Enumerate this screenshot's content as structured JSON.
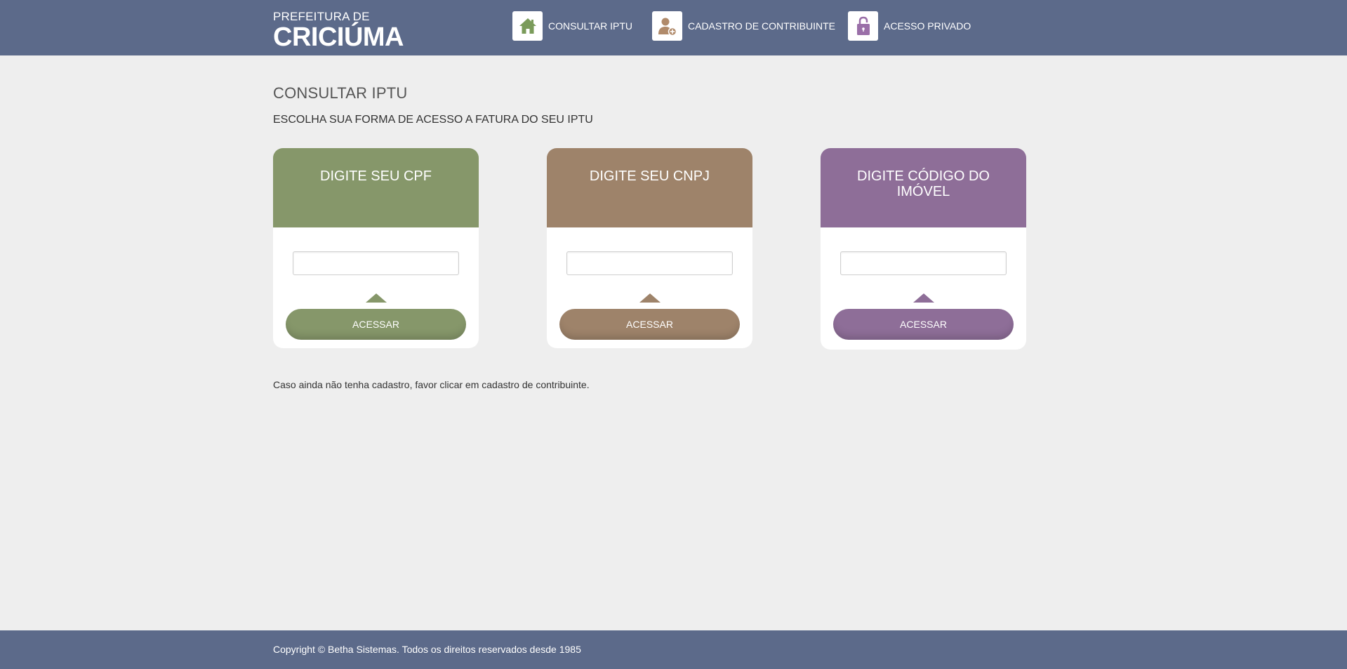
{
  "brand": {
    "top": "PREFEITURA DE",
    "main": "CRICIÚMA"
  },
  "nav": {
    "items": [
      {
        "label": "CONSULTAR IPTU",
        "icon": "house-icon"
      },
      {
        "label": "CADASTRO DE CONTRIBUINTE",
        "icon": "user-add-icon"
      },
      {
        "label": "ACESSO PRIVADO",
        "icon": "lock-icon"
      }
    ]
  },
  "main": {
    "title": "CONSULTAR IPTU",
    "subtitle": "ESCOLHA SUA FORMA DE ACESSO A FATURA DO SEU IPTU",
    "note": "Caso ainda não tenha cadastro, favor clicar em cadastro de contribuinte."
  },
  "cards": [
    {
      "title": "DIGITE SEU CPF",
      "input_value": "",
      "button": "ACESSAR",
      "color": "#86976a"
    },
    {
      "title": "DIGITE SEU CNPJ",
      "input_value": "",
      "button": "ACESSAR",
      "color": "#9e836a"
    },
    {
      "title": "DIGITE CÓDIGO DO IMÓVEL",
      "input_value": "",
      "button": "ACESSAR",
      "color": "#8e6e98"
    }
  ],
  "footer": {
    "text": "Copyright © Betha Sistemas. Todos os direitos reservados desde 1985"
  },
  "colors": {
    "header": "#5c6a8a",
    "background": "#eeeeee",
    "house_icon": "#7a9b5a",
    "user_icon": "#b08a6a",
    "lock_icon": "#9a6fa8"
  }
}
